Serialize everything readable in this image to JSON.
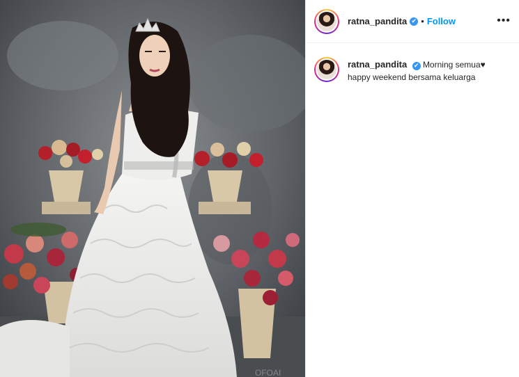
{
  "photo": {
    "watermark": "OFOAI"
  },
  "header": {
    "username": "ratna_pandita",
    "verified_glyph": "✔",
    "separator": "•",
    "follow_label": "Follow",
    "more_label": "•••"
  },
  "caption": {
    "username": "ratna_pandita",
    "verified_glyph": "✔",
    "line1": "Morning semua♥",
    "line2": "happy weekend bersama keluarga"
  },
  "colors": {
    "link": "#0095f6",
    "verified": "#3897f0",
    "text": "#262626"
  }
}
